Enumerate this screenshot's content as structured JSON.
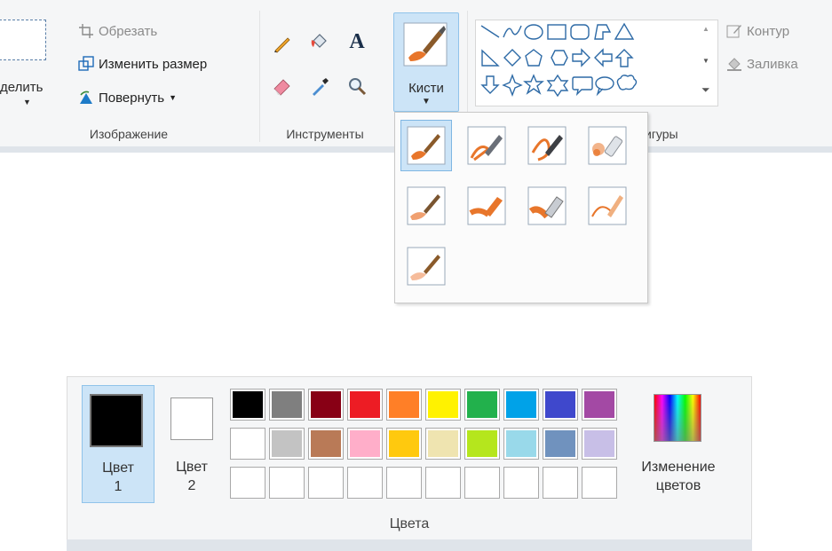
{
  "image_group": {
    "select_label_partial": "делить",
    "crop_label": "Обрезать",
    "resize_label": "Изменить размер",
    "rotate_label": "Повернуть",
    "caption": "Изображение"
  },
  "tools_group": {
    "text_tool_glyph": "A",
    "caption": "Инструменты",
    "tools": [
      "pencil-icon",
      "fill-bucket-icon",
      "text-icon",
      "eraser-icon",
      "color-picker-icon",
      "magnifier-icon"
    ]
  },
  "brushes": {
    "label": "Кисти",
    "options": [
      "brush",
      "calligraphy-brush-1",
      "calligraphy-brush-2",
      "airbrush",
      "oil-brush",
      "crayon",
      "marker",
      "natural-pencil",
      "watercolor-brush"
    ],
    "selected_index": 0
  },
  "shapes_group": {
    "caption_partial": "игуры",
    "outline_label": "Контур",
    "fill_label": "Заливка",
    "shapes": [
      "line",
      "curve",
      "oval",
      "rectangle",
      "rounded-rectangle",
      "polygon",
      "triangle",
      "right-triangle",
      "diamond",
      "pentagon",
      "hexagon",
      "right-arrow",
      "left-arrow",
      "up-arrow",
      "down-arrow",
      "four-point-star",
      "five-point-star",
      "six-point-star",
      "rounded-callout",
      "oval-callout",
      "cloud-callout"
    ]
  },
  "colors": {
    "color1_label": "Цвет\n1",
    "color1_line1": "Цвет",
    "color1_line2": "1",
    "color2_line1": "Цвет",
    "color2_line2": "2",
    "color1_value": "#000000",
    "color2_value": "#ffffff",
    "edit_label_line1": "Изменение",
    "edit_label_line2": "цветов",
    "caption": "Цвета",
    "palette_row1": [
      "#000000",
      "#7f7f7f",
      "#880015",
      "#ed1c24",
      "#ff7f27",
      "#fff200",
      "#22b14c",
      "#00a2e8",
      "#3f48cc",
      "#a349a4"
    ],
    "palette_row2": [
      "#ffffff",
      "#c3c3c3",
      "#b97a57",
      "#ffaec9",
      "#ffc90e",
      "#efe4b0",
      "#b5e61d",
      "#99d9ea",
      "#7092be",
      "#c8bfe7"
    ],
    "palette_row3_count": 10
  },
  "accent": "#cce4f7"
}
